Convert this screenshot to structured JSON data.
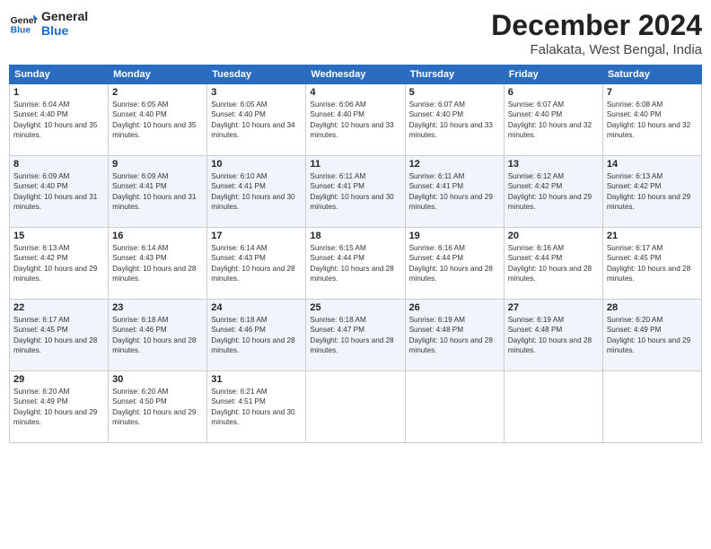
{
  "header": {
    "logo_general": "General",
    "logo_blue": "Blue",
    "month_title": "December 2024",
    "location": "Falakata, West Bengal, India"
  },
  "weekdays": [
    "Sunday",
    "Monday",
    "Tuesday",
    "Wednesday",
    "Thursday",
    "Friday",
    "Saturday"
  ],
  "weeks": [
    [
      {
        "day": "1",
        "sunrise": "6:04 AM",
        "sunset": "4:40 PM",
        "daylight": "10 hours and 35 minutes."
      },
      {
        "day": "2",
        "sunrise": "6:05 AM",
        "sunset": "4:40 PM",
        "daylight": "10 hours and 35 minutes."
      },
      {
        "day": "3",
        "sunrise": "6:05 AM",
        "sunset": "4:40 PM",
        "daylight": "10 hours and 34 minutes."
      },
      {
        "day": "4",
        "sunrise": "6:06 AM",
        "sunset": "4:40 PM",
        "daylight": "10 hours and 33 minutes."
      },
      {
        "day": "5",
        "sunrise": "6:07 AM",
        "sunset": "4:40 PM",
        "daylight": "10 hours and 33 minutes."
      },
      {
        "day": "6",
        "sunrise": "6:07 AM",
        "sunset": "4:40 PM",
        "daylight": "10 hours and 32 minutes."
      },
      {
        "day": "7",
        "sunrise": "6:08 AM",
        "sunset": "4:40 PM",
        "daylight": "10 hours and 32 minutes."
      }
    ],
    [
      {
        "day": "8",
        "sunrise": "6:09 AM",
        "sunset": "4:40 PM",
        "daylight": "10 hours and 31 minutes."
      },
      {
        "day": "9",
        "sunrise": "6:09 AM",
        "sunset": "4:41 PM",
        "daylight": "10 hours and 31 minutes."
      },
      {
        "day": "10",
        "sunrise": "6:10 AM",
        "sunset": "4:41 PM",
        "daylight": "10 hours and 30 minutes."
      },
      {
        "day": "11",
        "sunrise": "6:11 AM",
        "sunset": "4:41 PM",
        "daylight": "10 hours and 30 minutes."
      },
      {
        "day": "12",
        "sunrise": "6:11 AM",
        "sunset": "4:41 PM",
        "daylight": "10 hours and 29 minutes."
      },
      {
        "day": "13",
        "sunrise": "6:12 AM",
        "sunset": "4:42 PM",
        "daylight": "10 hours and 29 minutes."
      },
      {
        "day": "14",
        "sunrise": "6:13 AM",
        "sunset": "4:42 PM",
        "daylight": "10 hours and 29 minutes."
      }
    ],
    [
      {
        "day": "15",
        "sunrise": "6:13 AM",
        "sunset": "4:42 PM",
        "daylight": "10 hours and 29 minutes."
      },
      {
        "day": "16",
        "sunrise": "6:14 AM",
        "sunset": "4:43 PM",
        "daylight": "10 hours and 28 minutes."
      },
      {
        "day": "17",
        "sunrise": "6:14 AM",
        "sunset": "4:43 PM",
        "daylight": "10 hours and 28 minutes."
      },
      {
        "day": "18",
        "sunrise": "6:15 AM",
        "sunset": "4:44 PM",
        "daylight": "10 hours and 28 minutes."
      },
      {
        "day": "19",
        "sunrise": "6:16 AM",
        "sunset": "4:44 PM",
        "daylight": "10 hours and 28 minutes."
      },
      {
        "day": "20",
        "sunrise": "6:16 AM",
        "sunset": "4:44 PM",
        "daylight": "10 hours and 28 minutes."
      },
      {
        "day": "21",
        "sunrise": "6:17 AM",
        "sunset": "4:45 PM",
        "daylight": "10 hours and 28 minutes."
      }
    ],
    [
      {
        "day": "22",
        "sunrise": "6:17 AM",
        "sunset": "4:45 PM",
        "daylight": "10 hours and 28 minutes."
      },
      {
        "day": "23",
        "sunrise": "6:18 AM",
        "sunset": "4:46 PM",
        "daylight": "10 hours and 28 minutes."
      },
      {
        "day": "24",
        "sunrise": "6:18 AM",
        "sunset": "4:46 PM",
        "daylight": "10 hours and 28 minutes."
      },
      {
        "day": "25",
        "sunrise": "6:18 AM",
        "sunset": "4:47 PM",
        "daylight": "10 hours and 28 minutes."
      },
      {
        "day": "26",
        "sunrise": "6:19 AM",
        "sunset": "4:48 PM",
        "daylight": "10 hours and 28 minutes."
      },
      {
        "day": "27",
        "sunrise": "6:19 AM",
        "sunset": "4:48 PM",
        "daylight": "10 hours and 28 minutes."
      },
      {
        "day": "28",
        "sunrise": "6:20 AM",
        "sunset": "4:49 PM",
        "daylight": "10 hours and 29 minutes."
      }
    ],
    [
      {
        "day": "29",
        "sunrise": "6:20 AM",
        "sunset": "4:49 PM",
        "daylight": "10 hours and 29 minutes."
      },
      {
        "day": "30",
        "sunrise": "6:20 AM",
        "sunset": "4:50 PM",
        "daylight": "10 hours and 29 minutes."
      },
      {
        "day": "31",
        "sunrise": "6:21 AM",
        "sunset": "4:51 PM",
        "daylight": "10 hours and 30 minutes."
      },
      null,
      null,
      null,
      null
    ]
  ],
  "labels": {
    "sunrise": "Sunrise:",
    "sunset": "Sunset:",
    "daylight": "Daylight:"
  }
}
